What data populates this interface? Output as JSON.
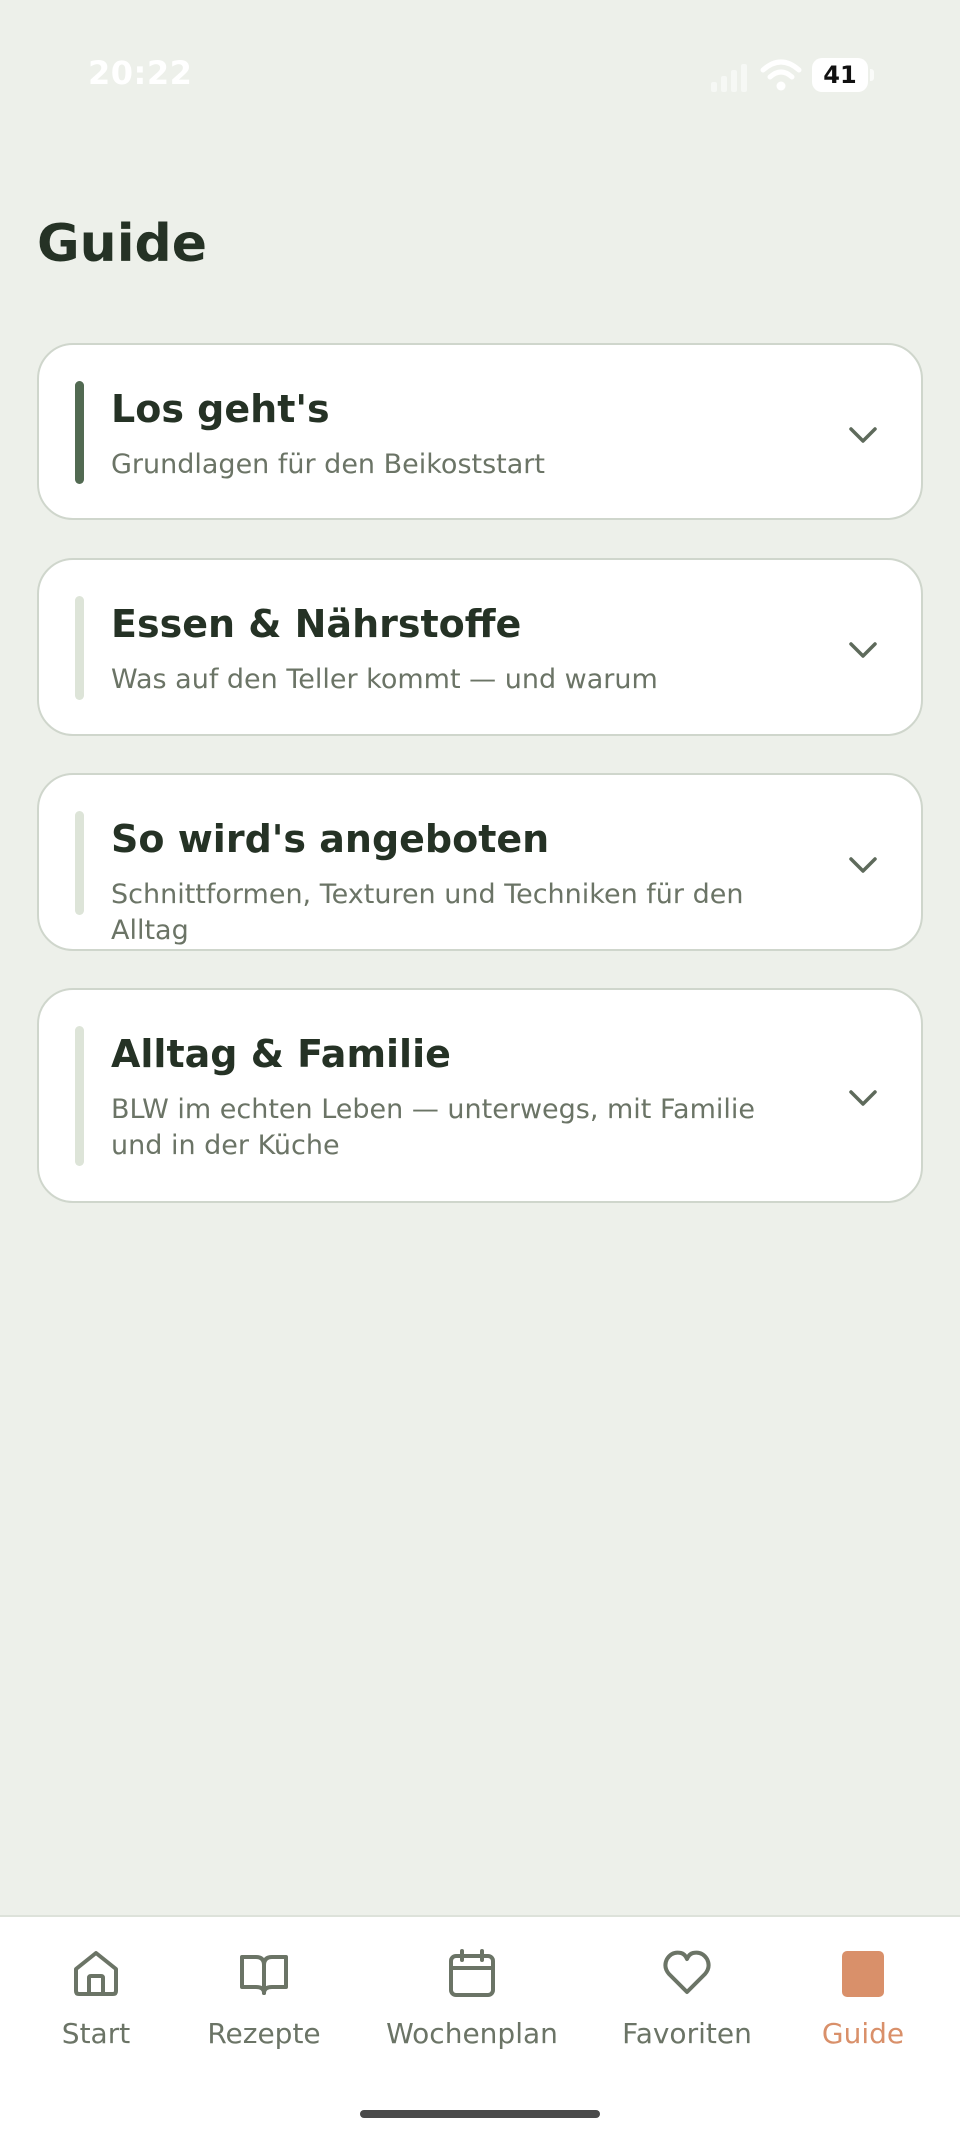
{
  "status_bar": {
    "time": "20:22",
    "battery": "41"
  },
  "page": {
    "title": "Guide"
  },
  "sections": [
    {
      "title": "Los geht's",
      "subtitle": "Grundlagen für den Beikoststart",
      "active": true
    },
    {
      "title": "Essen & Nährstoffe",
      "subtitle": "Was auf den Teller kommt — und warum",
      "active": false
    },
    {
      "title": "So wird's angeboten",
      "subtitle": "Schnittformen, Texturen und Techniken für den Alltag",
      "active": false
    },
    {
      "title": "Alltag & Familie",
      "subtitle": "BLW im echten Leben — unterwegs, mit Familie und in der Küche",
      "active": false
    }
  ],
  "nav": {
    "items": [
      {
        "label": "Start",
        "icon": "home-icon"
      },
      {
        "label": "Rezepte",
        "icon": "book-icon"
      },
      {
        "label": "Wochenplan",
        "icon": "calendar-icon"
      },
      {
        "label": "Favoriten",
        "icon": "heart-icon"
      },
      {
        "label": "Guide",
        "icon": "guide-icon",
        "active": true
      }
    ]
  },
  "colors": {
    "background": "#edf0ea",
    "accent_active": "#526a52",
    "accent_inactive": "#dde4d8",
    "nav_active": "#d9906a",
    "nav_inactive": "#6b7466"
  }
}
